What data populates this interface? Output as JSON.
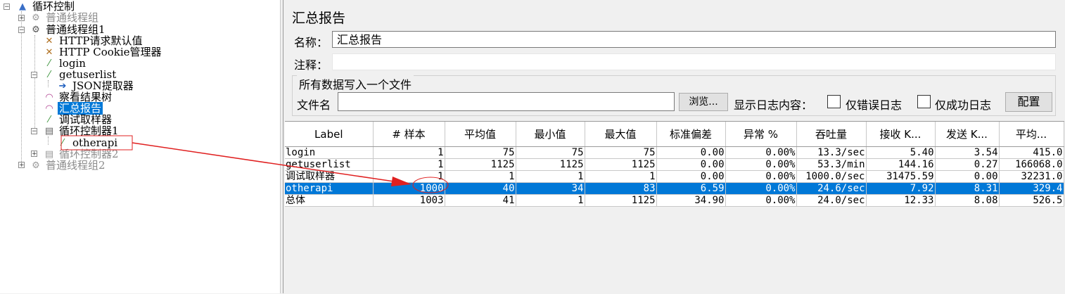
{
  "tree": {
    "nodes": [
      {
        "id": "loop-root",
        "label": "循环控制",
        "icon": "broom-icon",
        "dim": false,
        "sel": false
      },
      {
        "id": "tg1",
        "label": "普通线程组",
        "icon": "gear-icon",
        "dim": true,
        "sel": false
      },
      {
        "id": "tg11",
        "label": "普通线程组1",
        "icon": "gear-icon",
        "dim": false,
        "sel": false
      },
      {
        "id": "http-defaults",
        "label": "HTTP请求默认值",
        "icon": "wrench-icon",
        "dim": false,
        "sel": false
      },
      {
        "id": "cookie-mgr",
        "label": "HTTP Cookie管理器",
        "icon": "wrench-icon",
        "dim": false,
        "sel": false
      },
      {
        "id": "login",
        "label": "login",
        "icon": "pipette-icon",
        "dim": false,
        "sel": false
      },
      {
        "id": "getuserlist",
        "label": "getuserlist",
        "icon": "pipette-icon",
        "dim": false,
        "sel": false
      },
      {
        "id": "json-extractor",
        "label": "JSON提取器",
        "icon": "arrow-icon",
        "dim": false,
        "sel": false
      },
      {
        "id": "view-results-tree",
        "label": "察看结果树",
        "icon": "chart-icon",
        "dim": false,
        "sel": false
      },
      {
        "id": "summary-report",
        "label": "汇总报告",
        "icon": "chart-icon",
        "dim": false,
        "sel": true
      },
      {
        "id": "debug-sampler",
        "label": "调试取样器",
        "icon": "pipette-icon",
        "dim": false,
        "sel": false
      },
      {
        "id": "loop-ctrl1",
        "label": "循环控制器1",
        "icon": "loop-icon",
        "dim": false,
        "sel": false
      },
      {
        "id": "otherapi",
        "label": "otherapi",
        "icon": "pipette-icon",
        "dim": false,
        "sel": false
      },
      {
        "id": "loop-ctrl2",
        "label": "循环控制器2",
        "icon": "loop-icon",
        "dim": true,
        "sel": false
      },
      {
        "id": "tg2",
        "label": "普通线程组2",
        "icon": "gear-icon",
        "dim": true,
        "sel": false
      }
    ]
  },
  "panel": {
    "title": "汇总报告",
    "name_label": "名称：",
    "name_value": "汇总报告",
    "comment_label": "注释：",
    "comment_value": "",
    "file_group_legend": "所有数据写入一个文件",
    "file_label": "文件名",
    "file_value": "",
    "browse_button": "浏览...",
    "log_content_label": "显示日志内容：",
    "errors_only_label": "仅错误日志",
    "success_only_label": "仅成功日志",
    "configure_button": "配置"
  },
  "table": {
    "headers": [
      "Label",
      "# 样本",
      "平均值",
      "最小值",
      "最大值",
      "标准偏差",
      "异常 %",
      "吞吐量",
      "接收 K...",
      "发送 K...",
      "平均..."
    ],
    "rows": [
      [
        "login",
        "1",
        "75",
        "75",
        "75",
        "0.00",
        "0.00%",
        "13.3/sec",
        "5.40",
        "3.54",
        "415.0"
      ],
      [
        "getuserlist",
        "1",
        "1125",
        "1125",
        "1125",
        "0.00",
        "0.00%",
        "53.3/min",
        "144.16",
        "0.27",
        "166068.0"
      ],
      [
        "调试取样器",
        "1",
        "1",
        "1",
        "1",
        "0.00",
        "0.00%",
        "1000.0/sec",
        "31475.59",
        "0.00",
        "32231.0"
      ],
      [
        "otherapi",
        "1000",
        "40",
        "34",
        "83",
        "6.59",
        "0.00%",
        "24.6/sec",
        "7.92",
        "8.31",
        "329.4"
      ],
      [
        "总体",
        "1003",
        "41",
        "1",
        "1125",
        "34.90",
        "0.00%",
        "24.0/sec",
        "12.33",
        "8.08",
        "526.5"
      ]
    ],
    "selected_row": 3
  },
  "colors": {
    "selection": "#0078d7",
    "annotation": "#e02020"
  }
}
